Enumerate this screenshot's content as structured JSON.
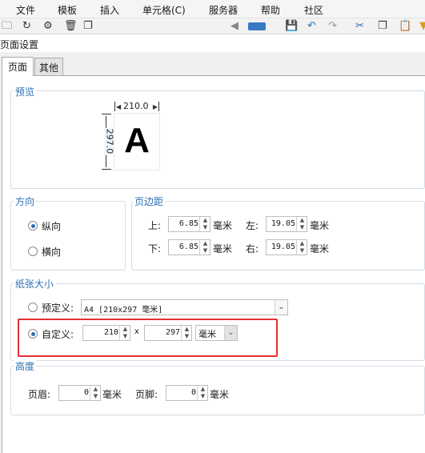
{
  "menubar": {
    "items": [
      "文件",
      "模板",
      "插入",
      "单元格(C)",
      "服务器",
      "帮助",
      "社区"
    ]
  },
  "toolbar": {
    "icons": [
      "open-icon",
      "redo-icon",
      "settings-icon",
      "trash-icon",
      "copy-icon",
      "save-icon",
      "undo-icon",
      "redo-arrow-icon",
      "cut-icon",
      "copy-doc-icon",
      "paste-icon"
    ]
  },
  "dialog": {
    "title": "页面设置",
    "tabs": [
      "页面",
      "其他"
    ]
  },
  "preview": {
    "title": "预览",
    "width_label": "210.0",
    "height_label": "297.0",
    "glyph": "A"
  },
  "orientation": {
    "title": "方向",
    "portrait": "纵向",
    "landscape": "横向",
    "selected": "portrait"
  },
  "margins": {
    "title": "页边距",
    "top_label": "上:",
    "top_value": "6.85",
    "left_label": "左:",
    "left_value": "19.05",
    "bottom_label": "下:",
    "bottom_value": "6.85",
    "right_label": "右:",
    "right_value": "19.05",
    "unit": "毫米"
  },
  "paper": {
    "title": "纸张大小",
    "preset_label": "预定义:",
    "preset_value": "A4 [210x297 毫米]",
    "custom_label": "自定义:",
    "width": "210",
    "times": "x",
    "height": "297",
    "unit": "毫米",
    "selected": "custom"
  },
  "height_group": {
    "title": "高度",
    "header_label": "页眉:",
    "header_value": "0",
    "footer_label": "页脚:",
    "footer_value": "0",
    "unit": "毫米"
  },
  "colors": {
    "accent": "#2b6fb3",
    "highlight": "#e53030"
  }
}
